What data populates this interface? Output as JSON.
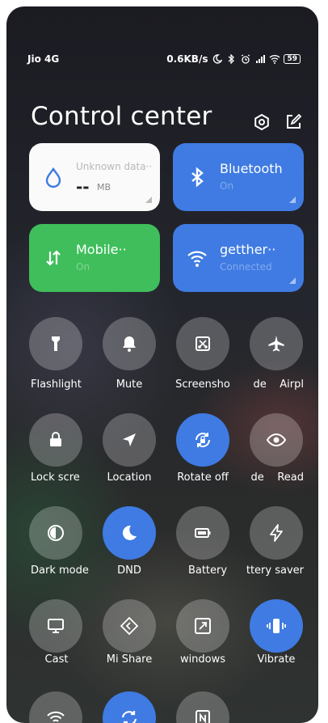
{
  "status_bar": {
    "carrier": "Jio 4G",
    "speed": "0.6KB/s",
    "battery": "59"
  },
  "header": {
    "title": "Control center"
  },
  "tiles": {
    "data": {
      "title": "Unknown data··",
      "value": "--",
      "unit": "MB"
    },
    "bluetooth": {
      "title": "Bluetooth",
      "status": "On"
    },
    "mobile": {
      "title": "Mobile··",
      "status": "On"
    },
    "wifi": {
      "title": "getther··",
      "status": "Connected"
    }
  },
  "toggles": [
    {
      "label": "Flashlight",
      "icon": "flashlight-icon"
    },
    {
      "label": "Mute",
      "icon": "bell-icon"
    },
    {
      "label": "Screensho",
      "icon": "screenshot-icon"
    },
    {
      "label": "de    Airpl",
      "icon": "airplane-icon"
    },
    {
      "label": "Lock scre",
      "icon": "lock-icon"
    },
    {
      "label": "Location",
      "icon": "location-icon"
    },
    {
      "label": "Rotate off",
      "icon": "rotate-lock-icon"
    },
    {
      "label": "de    Read",
      "icon": "eye-icon"
    },
    {
      "label": "Dark mode",
      "icon": "dark-mode-icon"
    },
    {
      "label": "DND",
      "icon": "moon-icon"
    },
    {
      "label": "Battery",
      "icon": "battery-icon"
    },
    {
      "label": "ttery saver",
      "icon": "lightning-icon"
    },
    {
      "label": "Cast",
      "icon": "monitor-icon"
    },
    {
      "label": "Mi Share",
      "icon": "mi-share-icon"
    },
    {
      "label": "windows",
      "icon": "floating-window-icon"
    },
    {
      "label": "Vibrate",
      "icon": "vibrate-icon"
    },
    {
      "label": "",
      "icon": "wifi-hotspot-icon"
    },
    {
      "label": "",
      "icon": "sync-icon"
    },
    {
      "label": "",
      "icon": "nfc-icon"
    }
  ],
  "colors": {
    "accent_blue": "#3f7be3",
    "mobile_green": "#3fbe5b",
    "toggle_bg": "rgba(255,255,255,0.24)"
  }
}
